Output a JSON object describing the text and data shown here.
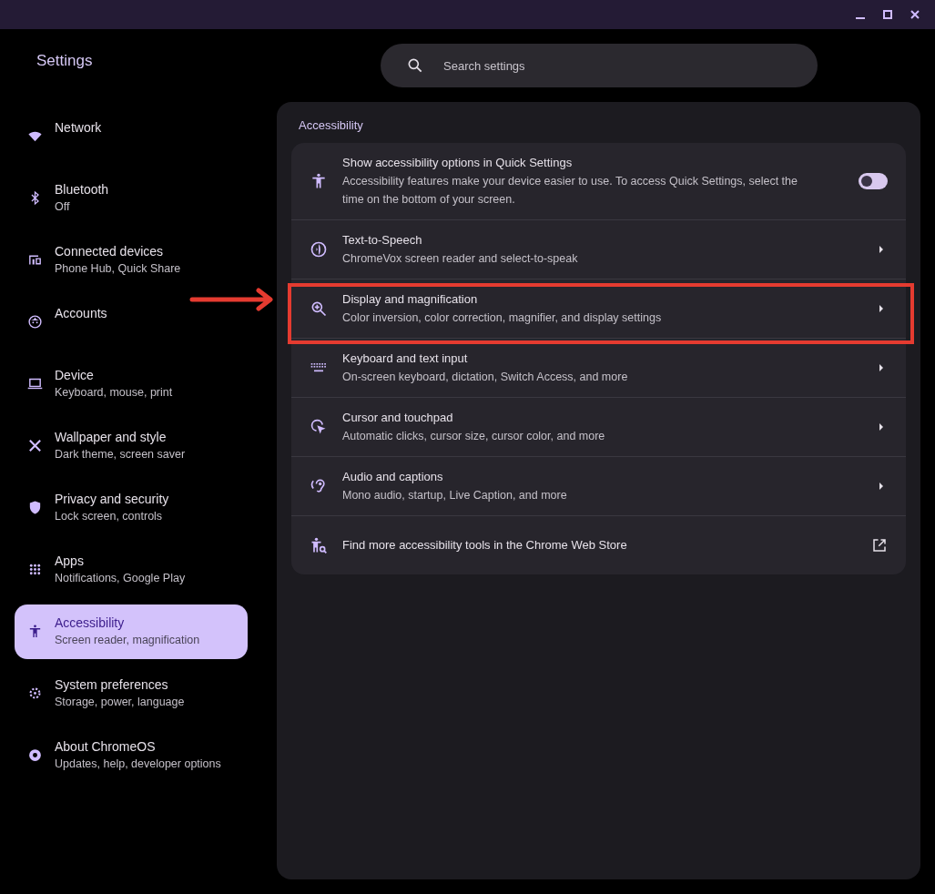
{
  "app_title": "Settings",
  "search": {
    "placeholder": "Search settings"
  },
  "sidebar": {
    "items": [
      {
        "title": "Network",
        "selected": false
      },
      {
        "title": "Bluetooth",
        "subtitle": "Off",
        "selected": false
      },
      {
        "title": "Connected devices",
        "subtitle": "Phone Hub, Quick Share",
        "selected": false
      },
      {
        "title": "Accounts",
        "selected": false
      },
      {
        "title": "Device",
        "subtitle": "Keyboard, mouse, print",
        "selected": false
      },
      {
        "title": "Wallpaper and style",
        "subtitle": "Dark theme, screen saver",
        "selected": false
      },
      {
        "title": "Privacy and security",
        "subtitle": "Lock screen, controls",
        "selected": false
      },
      {
        "title": "Apps",
        "subtitle": "Notifications, Google Play",
        "selected": false
      },
      {
        "title": "Accessibility",
        "subtitle": "Screen reader, magnification",
        "selected": true
      },
      {
        "title": "System preferences",
        "subtitle": "Storage, power, language",
        "selected": false
      },
      {
        "title": "About ChromeOS",
        "subtitle": "Updates, help, developer options",
        "selected": false
      }
    ]
  },
  "page": {
    "heading": "Accessibility",
    "rows": [
      {
        "kind": "toggle",
        "title": "Show accessibility options in Quick Settings",
        "description": "Accessibility features make your device easier to use. To access Quick Settings, select the time on the bottom of your screen.",
        "on": false,
        "highlighted": false
      },
      {
        "kind": "link",
        "title": "Text-to-Speech",
        "description": "ChromeVox screen reader and select-to-speak",
        "highlighted": false
      },
      {
        "kind": "link",
        "title": "Display and magnification",
        "description": "Color inversion, color correction, magnifier, and display settings",
        "highlighted": true
      },
      {
        "kind": "link",
        "title": "Keyboard and text input",
        "description": "On-screen keyboard, dictation, Switch Access, and more",
        "highlighted": false
      },
      {
        "kind": "link",
        "title": "Cursor and touchpad",
        "description": "Automatic clicks, cursor size, cursor color, and more",
        "highlighted": false
      },
      {
        "kind": "link",
        "title": "Audio and captions",
        "description": "Mono audio, startup, Live Caption, and more",
        "highlighted": false
      },
      {
        "kind": "external",
        "title": "Find more accessibility tools in the Chrome Web Store",
        "highlighted": false
      }
    ]
  }
}
